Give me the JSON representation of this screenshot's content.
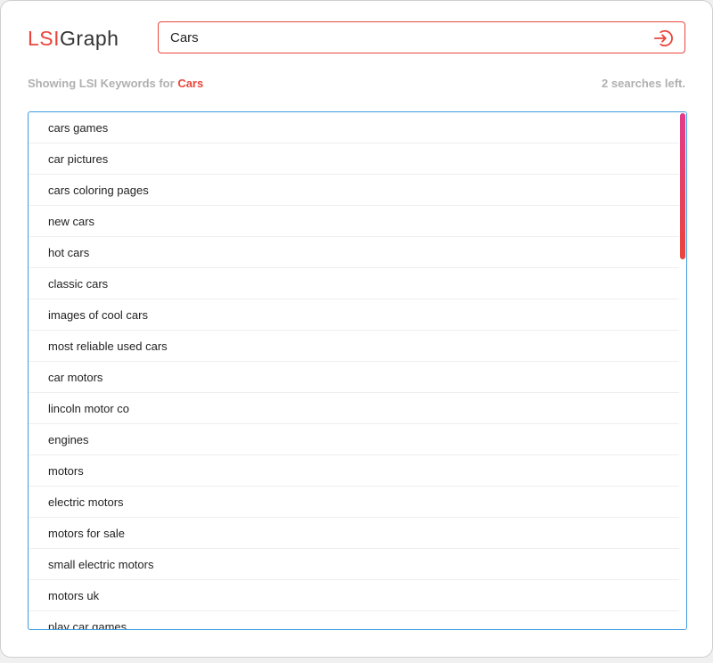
{
  "logo": {
    "part1": "LSI",
    "part2": "Graph"
  },
  "search": {
    "value": "Cars",
    "submit_icon": "login-arrow-icon"
  },
  "status": {
    "prefix": "Showing LSI Keywords for",
    "term": "Cars",
    "searches_left": "2 searches left."
  },
  "keywords": [
    "cars games",
    "car pictures",
    "cars coloring pages",
    "new cars",
    "hot cars",
    "classic cars",
    "images of cool cars",
    "most reliable used cars",
    "car motors",
    "lincoln motor co",
    "engines",
    "motors",
    "electric motors",
    "motors for sale",
    "small electric motors",
    "motors uk",
    "play car games"
  ],
  "colors": {
    "accent": "#e8463c",
    "list_border": "#3d9be0",
    "muted": "#b0b0b0"
  }
}
